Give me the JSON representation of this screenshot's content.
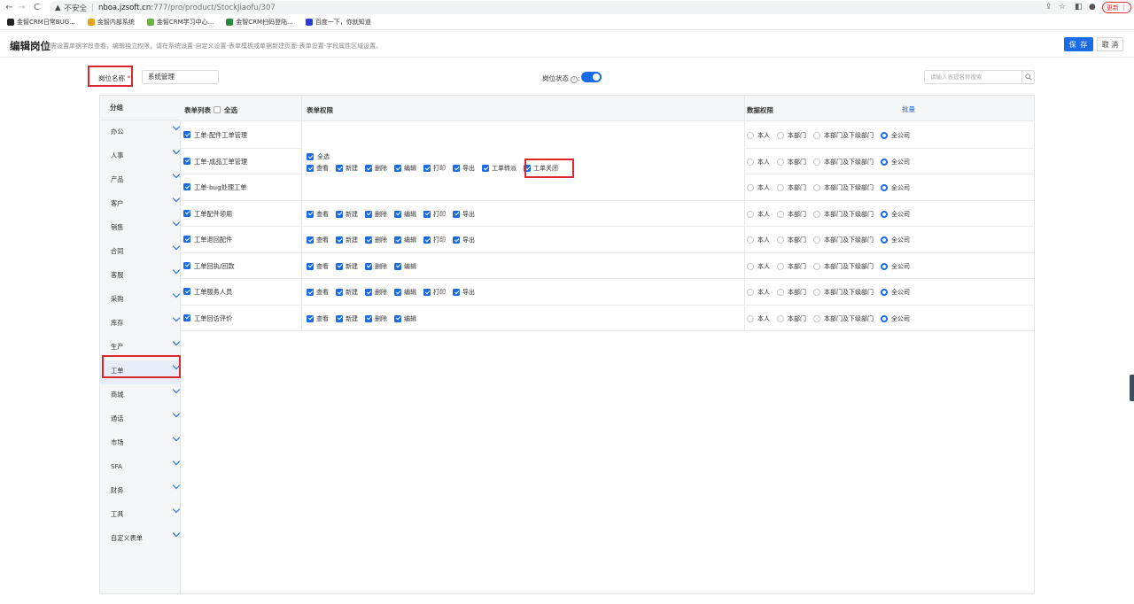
{
  "browser": {
    "nav": {
      "back": "←",
      "forward": "→",
      "reload": "C"
    },
    "warning_icon": "warning-triangle-icon",
    "security_text": "不安全",
    "url_host": "nboa.jzsoft.cn",
    "url_path": ":777/pro/product/StockJiaofu/307",
    "update_label": "更新",
    "bookmarks": [
      {
        "label": "金智CRM日常BUG...",
        "color": "#222222"
      },
      {
        "label": "金智内部系统",
        "color": "#e8a317"
      },
      {
        "label": "金智CRM学习中心...",
        "color": "#6cb33f"
      },
      {
        "label": "金智CRM扫码登陆...",
        "color": "#2a8a3a"
      },
      {
        "label": "百度一下，你就知道",
        "color": "#2b3bd6"
      }
    ]
  },
  "header": {
    "title": "编辑岗位",
    "description": "如需设置单据字段查看，编辑独立权限，请在系统设置-自定义设置-表单模板或单据新建页面-表单设置-字段属性区域设置。",
    "save_label": "保 存",
    "cancel_label": "取 消"
  },
  "form": {
    "name_label": "岗位名称",
    "required_mark": "*",
    "name_value": "系统管理",
    "status_label": "岗位状态",
    "status_help": "?",
    "status_colon": ":",
    "status_on": true,
    "search_placeholder": "请输入表提名称搜索"
  },
  "sidebar": {
    "head": "分组",
    "groups": [
      "办公",
      "人事",
      "产品",
      "客户",
      "销售",
      "合同",
      "客服",
      "采购",
      "库存",
      "生产",
      "工单",
      "商城",
      "通话",
      "市场",
      "SFA",
      "财务",
      "工具",
      "自定义表单"
    ],
    "active": "工单"
  },
  "table": {
    "col_forms": "表单列表",
    "select_all": "全选",
    "col_perms": "表单权限",
    "col_data": "数据权限",
    "batch": "批量",
    "data_options": [
      "本人",
      "本部门",
      "本部门及下级部门",
      "全公司"
    ],
    "selected_data_option": "全公司",
    "merged_select_all": "全选",
    "merged_perms": [
      "查看",
      "新建",
      "删除",
      "编辑",
      "打印",
      "导出",
      "工单转派",
      "工单关闭"
    ],
    "rows": [
      {
        "name": "工单-配件工单管理",
        "perms": []
      },
      {
        "name": "工单-成品工单管理",
        "perms": []
      },
      {
        "name": "工单-bug处理工单",
        "perms": []
      },
      {
        "name": "工单配件领用",
        "perms": [
          "查看",
          "新建",
          "删除",
          "编辑",
          "打印",
          "导出"
        ]
      },
      {
        "name": "工单退回配件",
        "perms": [
          "查看",
          "新建",
          "删除",
          "编辑",
          "打印",
          "导出"
        ]
      },
      {
        "name": "工单回执/回款",
        "perms": [
          "查看",
          "新建",
          "删除",
          "编辑"
        ]
      },
      {
        "name": "工单服务人员",
        "perms": [
          "查看",
          "新建",
          "删除",
          "编辑",
          "打印",
          "导出"
        ]
      },
      {
        "name": "工单回访评价",
        "perms": [
          "查看",
          "新建",
          "删除",
          "编辑"
        ]
      }
    ]
  }
}
